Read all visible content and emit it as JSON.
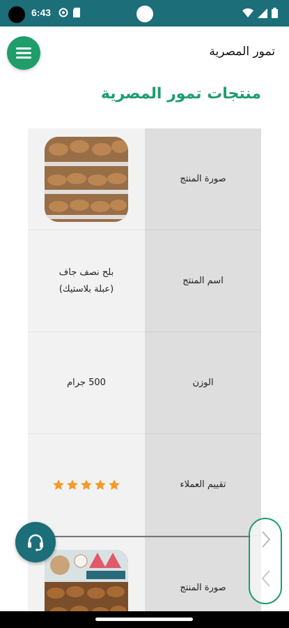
{
  "status_bar": {
    "time": "6:43",
    "icons_left": [
      "data-saver-icon",
      "sd-card-icon"
    ],
    "icons_right": [
      "wifi-icon",
      "signal-icon",
      "battery-icon"
    ],
    "background": "#1c6e79"
  },
  "app_bar": {
    "title": "تمور المصرية",
    "menu_icon": "hamburger-menu-icon",
    "accent": "#1f9d6b"
  },
  "page": {
    "title": "منتجات تمور المصرية"
  },
  "product_table": {
    "rows": [
      {
        "label": "صورة المنتج",
        "type": "image",
        "image_icon": "dates-plastic-box-image"
      },
      {
        "label": "اسم المنتج",
        "type": "text",
        "value_line1": "بلح نصف جاف",
        "value_line2": "(عبلة بلاستيك)"
      },
      {
        "label": "الوزن",
        "type": "text",
        "value": "500 جرام"
      },
      {
        "label": "تقييم العملاء",
        "type": "rating",
        "rating": 5,
        "max_rating": 5,
        "star_color": "#f39a2a"
      },
      {
        "label": "صورة المنتج",
        "type": "image",
        "image_icon": "dates-gift-box-image"
      }
    ]
  },
  "floating": {
    "support_icon": "headset-support-icon",
    "next_icon": "chevron-right-icon",
    "prev_icon": "chevron-left-icon"
  }
}
